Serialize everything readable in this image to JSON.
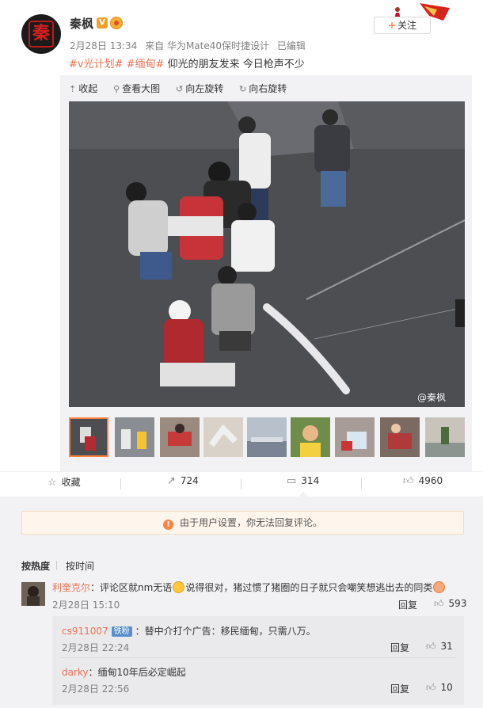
{
  "header": {
    "avatar_text": "秦",
    "username": "秦枫",
    "verified_label": "V",
    "follow_label": "关注",
    "follow_plus": "+",
    "timestamp": "2月28日 13:34",
    "source": "来自 华为Mate40保时捷设计",
    "edited": "已编辑"
  },
  "post": {
    "tag1": "#v光计划#",
    "tag2": "#缅甸#",
    "text": "仰光的朋友发来 今日枪声不少"
  },
  "image_toolbar": {
    "collapse": "收起",
    "view_large": "查看大图",
    "rotate_left": "向左旋转",
    "rotate_right": "向右旋转"
  },
  "watermark": "@秦枫",
  "actions": {
    "favorite": "收藏",
    "repost_count": "724",
    "comment_count": "314",
    "like_count": "4960"
  },
  "notice": "由于用户设置，你无法回复评论。",
  "sort": {
    "hot": "按热度",
    "time": "按时间"
  },
  "comments": [
    {
      "user": "利奎克尔",
      "text_a": "：评论区就nm无语",
      "text_b": "说得很对，猪过惯了猪圈的日子就只会嘲笑想逃出去的同类",
      "time": "2月28日 15:10",
      "reply": "回复",
      "likes": "593"
    }
  ],
  "replies": [
    {
      "user": "cs911007",
      "badge": "铁粉",
      "text": "：替中介打个广告：移民缅甸，只需八万。",
      "time": "2月28日 22:24",
      "reply": "回复",
      "likes": "31"
    },
    {
      "user": "darky",
      "text": "：缅甸10年后必定崛起",
      "time": "2月28日 22:56",
      "reply": "回复",
      "likes": "10"
    }
  ],
  "colors": {
    "accent_orange": "#ff8140",
    "link_orange": "#eb7350",
    "panel_bg": "#f2f2f5"
  }
}
